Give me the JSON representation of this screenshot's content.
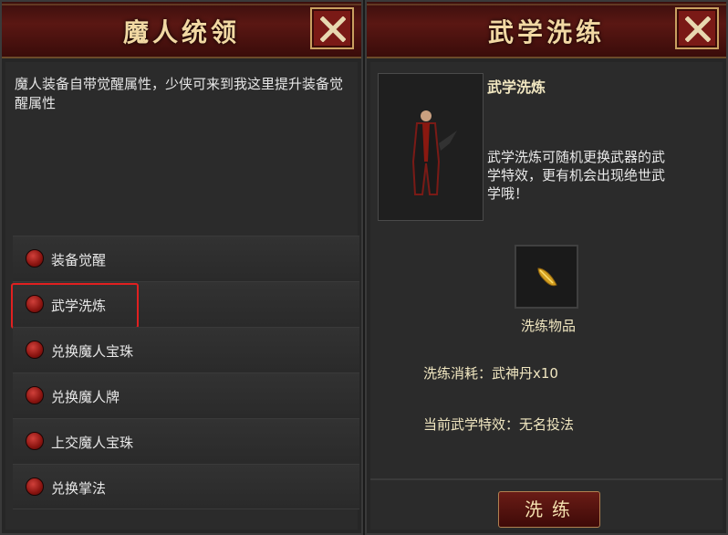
{
  "left": {
    "title": "魔人统领",
    "description": "魔人装备自带觉醒属性，少侠可来到我这里提升装备觉醒属性",
    "menu": [
      {
        "label": "装备觉醒"
      },
      {
        "label": "武学洗炼"
      },
      {
        "label": "兑换魔人宝珠"
      },
      {
        "label": "兑换魔人牌"
      },
      {
        "label": "上交魔人宝珠"
      },
      {
        "label": "兑换掌法"
      }
    ],
    "highlighted_item": "武学洗炼"
  },
  "right": {
    "title": "武学洗练",
    "info_title": "武学洗炼",
    "info_desc": "武学洗炼可随机更换武器的武学特效，更有机会出现绝世武学哦！",
    "item_label": "洗练物品",
    "cost": "洗练消耗：武神丹x10",
    "current_effect": "当前武学特效：无名投法",
    "action_label": "洗练"
  },
  "icons": {
    "close": "close-icon",
    "item": "golden-dart-icon",
    "portrait": "character-portrait"
  },
  "colors": {
    "title_bar": "#5a1713",
    "title_text": "#f1d8a3",
    "highlight": "#e02020",
    "accent_text": "#f0e6c0"
  }
}
